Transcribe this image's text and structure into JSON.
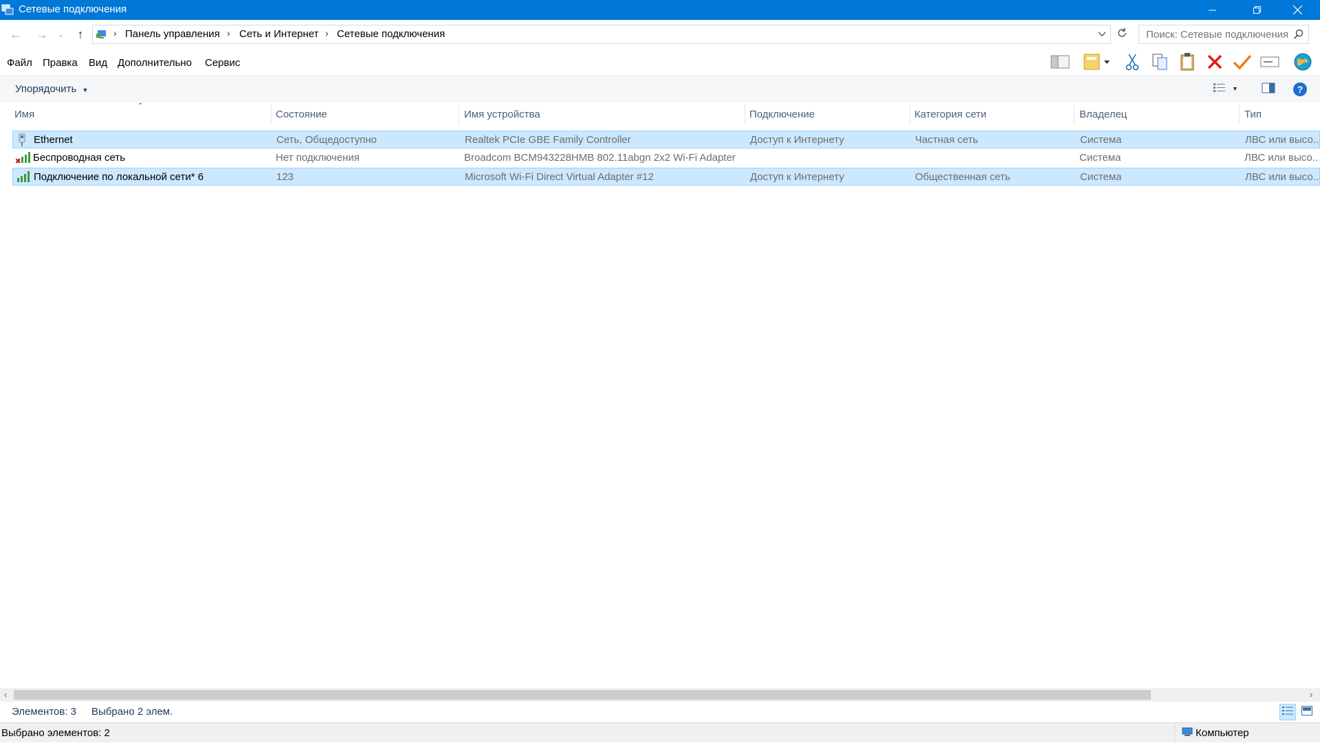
{
  "window": {
    "title": "Сетевые подключения",
    "accent_color": "#0078d7"
  },
  "address_bar": {
    "breadcrumbs": [
      "Панель управления",
      "Сеть и Интернет",
      "Сетевые подключения"
    ],
    "search_placeholder": "Поиск: Сетевые подключения"
  },
  "menu": {
    "items": [
      "Файл",
      "Правка",
      "Вид",
      "Дополнительно",
      "Сервис"
    ]
  },
  "command_bar": {
    "organize_label": "Упорядочить"
  },
  "columns": [
    "Имя",
    "Состояние",
    "Имя устройства",
    "Подключение",
    "Категория сети",
    "Владелец",
    "Тип"
  ],
  "rows": [
    {
      "name": "Ethernet",
      "icon": "ethernet-adapter-icon",
      "status": "Сеть, Общедоступно",
      "device": "Realtek PCIe GBE Family Controller",
      "connection": "Доступ к Интернету",
      "category": "Частная сеть",
      "owner": "Система",
      "type": "ЛВС или высо...",
      "selected": true
    },
    {
      "name": "Беспроводная сеть",
      "icon": "wifi-disconnected-icon",
      "status": "Нет подключения",
      "device": "Broadcom BCM943228HMB 802.11abgn 2x2 Wi-Fi Adapter",
      "connection": "",
      "category": "",
      "owner": "Система",
      "type": "ЛВС или высо...",
      "selected": false
    },
    {
      "name": "Подключение по локальной сети* 6",
      "icon": "wifi-signal-icon",
      "status": "123",
      "device": "Microsoft Wi-Fi Direct Virtual Adapter #12",
      "connection": "Доступ к Интернету",
      "category": "Общественная сеть",
      "owner": "Система",
      "type": "ЛВС или высо...",
      "selected": true
    }
  ],
  "status": {
    "items_count": "Элементов: 3",
    "selected_count": "Выбрано 2 элем.",
    "bottom_text": "Выбрано элементов: 2",
    "zone": "Компьютер"
  }
}
